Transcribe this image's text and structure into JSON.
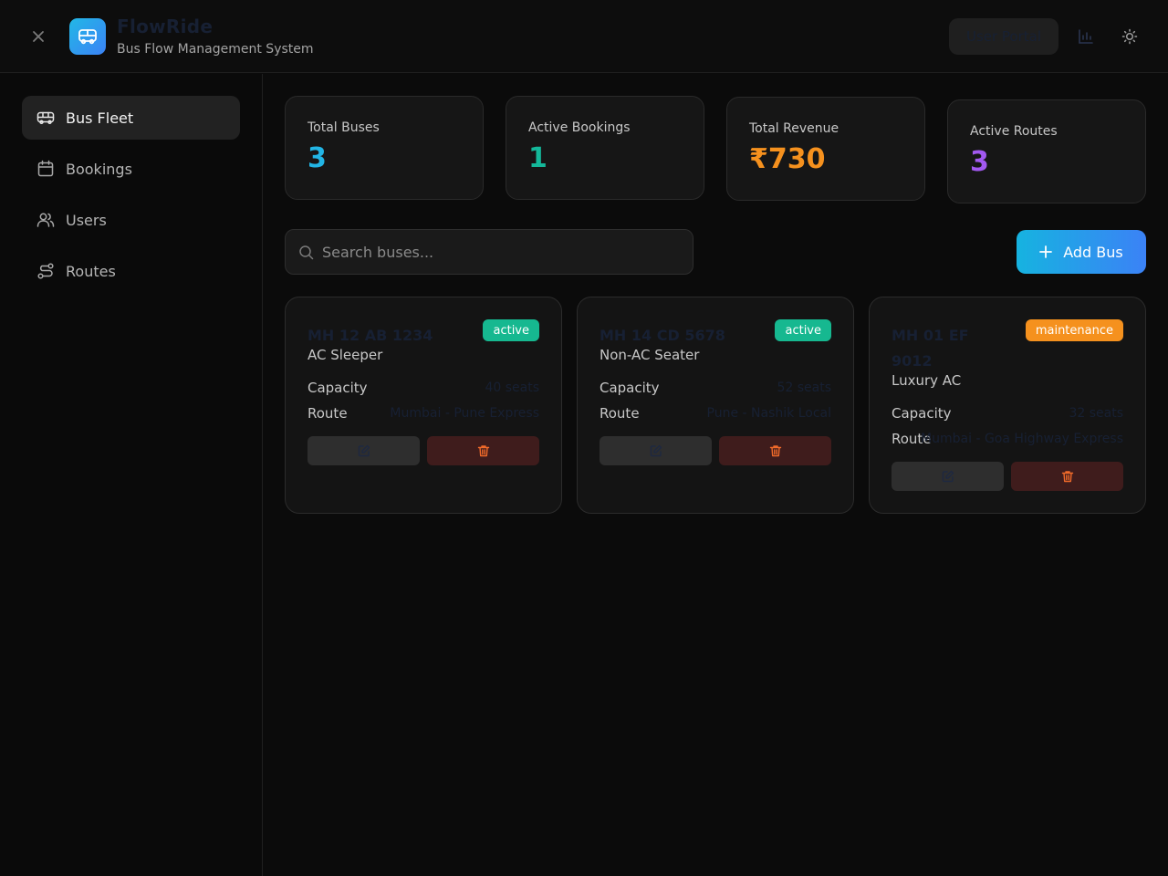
{
  "header": {
    "brand_title": "FlowRide",
    "brand_subtitle": "Bus Flow Management System",
    "portal_button": "User Portal"
  },
  "sidebar": {
    "items": [
      {
        "label": "Bus Fleet",
        "icon": "bus-icon",
        "active": true
      },
      {
        "label": "Bookings",
        "icon": "calendar-icon",
        "active": false
      },
      {
        "label": "Users",
        "icon": "users-icon",
        "active": false
      },
      {
        "label": "Routes",
        "icon": "route-icon",
        "active": false
      }
    ]
  },
  "stats": [
    {
      "label": "Total Buses",
      "value": "3",
      "color": "#22b5e5"
    },
    {
      "label": "Active Bookings",
      "value": "1",
      "color": "#14b89a"
    },
    {
      "label": "Total Revenue",
      "value": "₹730",
      "color": "#f5911e"
    },
    {
      "label": "Active Routes",
      "value": "3",
      "color": "#a259f0"
    }
  ],
  "search": {
    "placeholder": "Search buses..."
  },
  "add_button": {
    "label": "Add Bus"
  },
  "buses": [
    {
      "number": "MH 12 AB 1234",
      "type": "AC Sleeper",
      "status": "active",
      "status_color": "#16b890",
      "capacity_label": "Capacity",
      "capacity": "40 seats",
      "route_label": "Route",
      "route": "Mumbai - Pune Express"
    },
    {
      "number": "MH 14 CD 5678",
      "type": "Non-AC Seater",
      "status": "active",
      "status_color": "#16b890",
      "capacity_label": "Capacity",
      "capacity": "52 seats",
      "route_label": "Route",
      "route": "Pune - Nashik Local"
    },
    {
      "number": "MH 01 EF 9012",
      "type": "Luxury AC",
      "status": "maintenance",
      "status_color": "#f5911e",
      "capacity_label": "Capacity",
      "capacity": "32 seats",
      "route_label": "Route",
      "route": "Mumbai - Goa Highway Express"
    }
  ]
}
